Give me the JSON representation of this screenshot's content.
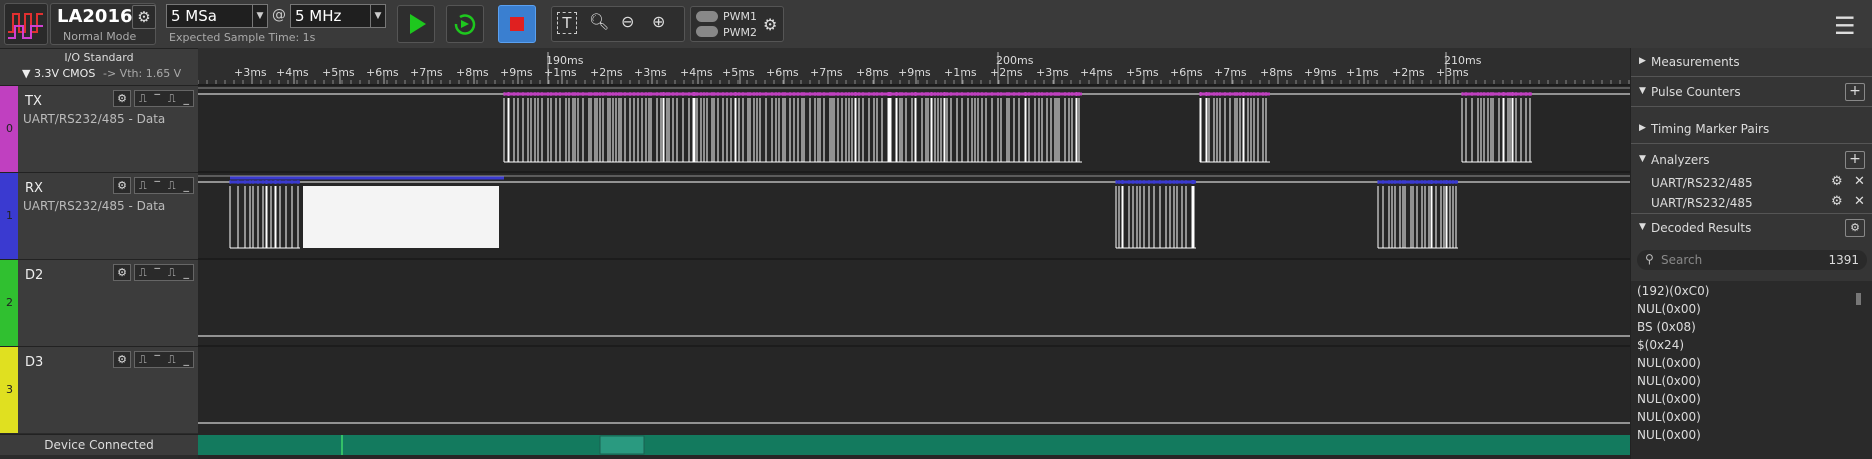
{
  "app": {
    "device": "LA2016",
    "mode": "Normal Mode"
  },
  "toolbar": {
    "sample_count": "5 MSa",
    "at": "@",
    "sample_rate": "5 MHz",
    "expected": "Expected Sample Time: 1s",
    "pwm": [
      "PWM1",
      "PWM2"
    ]
  },
  "io": {
    "title": "I/O Standard",
    "value": "3.3V CMOS",
    "vth": "-> Vth: 1.65 V"
  },
  "channels": [
    {
      "index": "0",
      "name": "TX",
      "desc": "UART/RS232/485 - Data",
      "color": "#c040c0"
    },
    {
      "index": "1",
      "name": "RX",
      "desc": "UART/RS232/485 - Data",
      "color": "#3a3ad0"
    },
    {
      "index": "2",
      "name": "D2",
      "desc": "",
      "color": "#30c030"
    },
    {
      "index": "3",
      "name": "D3",
      "desc": "",
      "color": "#e0e020"
    }
  ],
  "status": "Device Connected",
  "ruler": {
    "major": [
      "190ms",
      "200ms",
      "210ms"
    ],
    "minor": [
      "+3ms",
      "+4ms",
      "+5ms",
      "+6ms",
      "+7ms",
      "+8ms",
      "+9ms",
      "+1ms",
      "+2ms",
      "+3ms",
      "+4ms",
      "+5ms",
      "+6ms",
      "+7ms",
      "+8ms",
      "+9ms",
      "+1ms",
      "+2ms",
      "+3ms",
      "+4ms",
      "+5ms",
      "+6ms",
      "+7ms",
      "+8ms",
      "+9ms",
      "+1ms",
      "+2ms",
      "+3ms"
    ]
  },
  "panel": {
    "measurements": "Measurements",
    "pulse_counters": "Pulse Counters",
    "timing": "Timing Marker Pairs",
    "analyzers": "Analyzers",
    "analyzer_items": [
      "UART/RS232/485",
      "UART/RS232/485"
    ],
    "decoded": "Decoded Results",
    "search_placeholder": "Search",
    "count": "1391",
    "results": [
      "(192)(0xC0)",
      "NUL(0x00)",
      "BS (0x08)",
      "$(0x24)",
      "NUL(0x00)",
      "NUL(0x00)",
      "NUL(0x00)",
      "NUL(0x00)",
      "NUL(0x00)"
    ]
  },
  "colors": {
    "tx": "#c040c0",
    "rx": "#3a3ad0",
    "scroll": "#137a5e",
    "accent": "#3a7fd0"
  }
}
